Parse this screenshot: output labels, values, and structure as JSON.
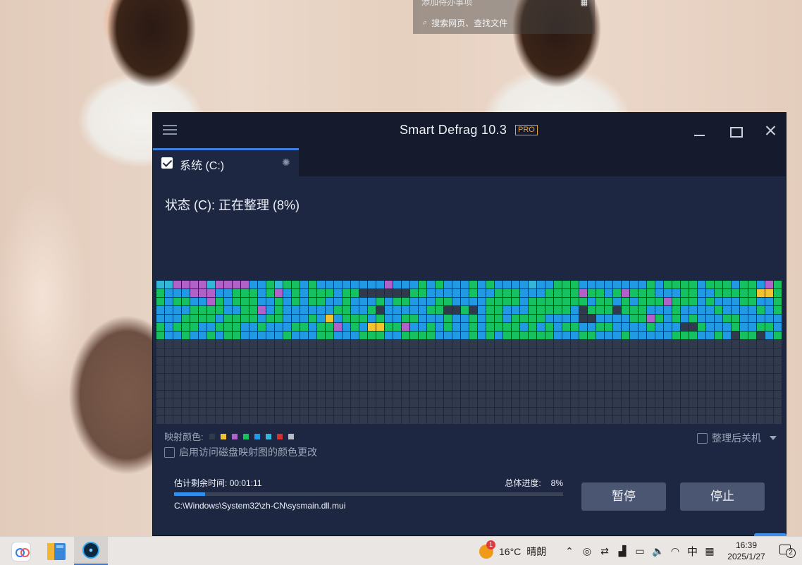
{
  "search_panel": {
    "top_hint": "添加待办事项",
    "placeholder": "搜索网页、查找文件"
  },
  "app": {
    "title": "Smart Defrag 10.3",
    "pro_badge": "PRO",
    "drive_tab_label": "系统 (C:)",
    "status_text": "状态 (C): 正在整理 (8%)",
    "legend_label": "映射颜色:",
    "legend_colors": [
      "#313a4d",
      "#f1c232",
      "#b062c8",
      "#17c060",
      "#219ae3",
      "#34b7d7",
      "#d23232",
      "#b8bcc6"
    ],
    "color_change_option": "启用访问磁盘映射图的颜色更改",
    "shutdown_option": "整理后关机",
    "eta_label": "估计剩余时间:",
    "eta_value": "00:01:11",
    "overall_label": "总体进度:",
    "overall_value": "8%",
    "overall_progress_fraction": 0.08,
    "current_file": "C:\\Windows\\System32\\zh-CN\\sysmain.dll.mui",
    "pause_button": "暂停",
    "stop_button": "停止",
    "colors": {
      "accent_blue": "#2e8ff0",
      "pro_orange": "#e8a23a",
      "window_bg": "#1e2742",
      "titlebar_bg": "#151b2c"
    }
  },
  "disk_map": {
    "columns": 74,
    "rows": 17,
    "cell_states": [
      "3344443444422131121222222224222121222121222232211122222222121111211121124122",
      "1222444221112142121112110000001122222122111222111141121411122211221111155122",
      "1211224121112212121122122212112221122221111211111112112121114111212221122111",
      "2222111122114212222221122102222211001021122211111201110111222122221222212112",
      "2221111211112112221252111212211222122121121111222200222211412121222112222212",
      "1211122111221222112114212551142212122121111212121122112222122200122212211222",
      "1221221211222221222112221112211112222121211111122211222122222111221201102121",
      "0000000000000000000000000000000000000000000000000000000000000000000000000000",
      "0000000000000000000000000000000000000000000000000000000000000000000000000000",
      "0000000000000000000000000000000000000000000000000000000000000000000000000000",
      "0000000000000000000000000000000000000000000000000000000000000000000000000000",
      "0000000000000000000000000000000000000000000000000000000000000000000000000000",
      "0000000000000000000000000000000000000000000000000000000000000000000000000000",
      "0000000000000000000000000000000000000000000000000000000000000000000000000000",
      "0000000000000000000000000000000000000000000000000000000000000000000000000000",
      "0000000000000000000000000000000000000000000000000000000000000000000000000000",
      "0000000000000000000000000000000000000000000000000000000000000000000000000000"
    ]
  },
  "taskbar": {
    "weather_badge": "1",
    "weather_temp": "16°C",
    "weather_text": "晴朗",
    "ime": "中",
    "time": "16:39",
    "date": "2025/1/27",
    "notification_count": "2"
  }
}
